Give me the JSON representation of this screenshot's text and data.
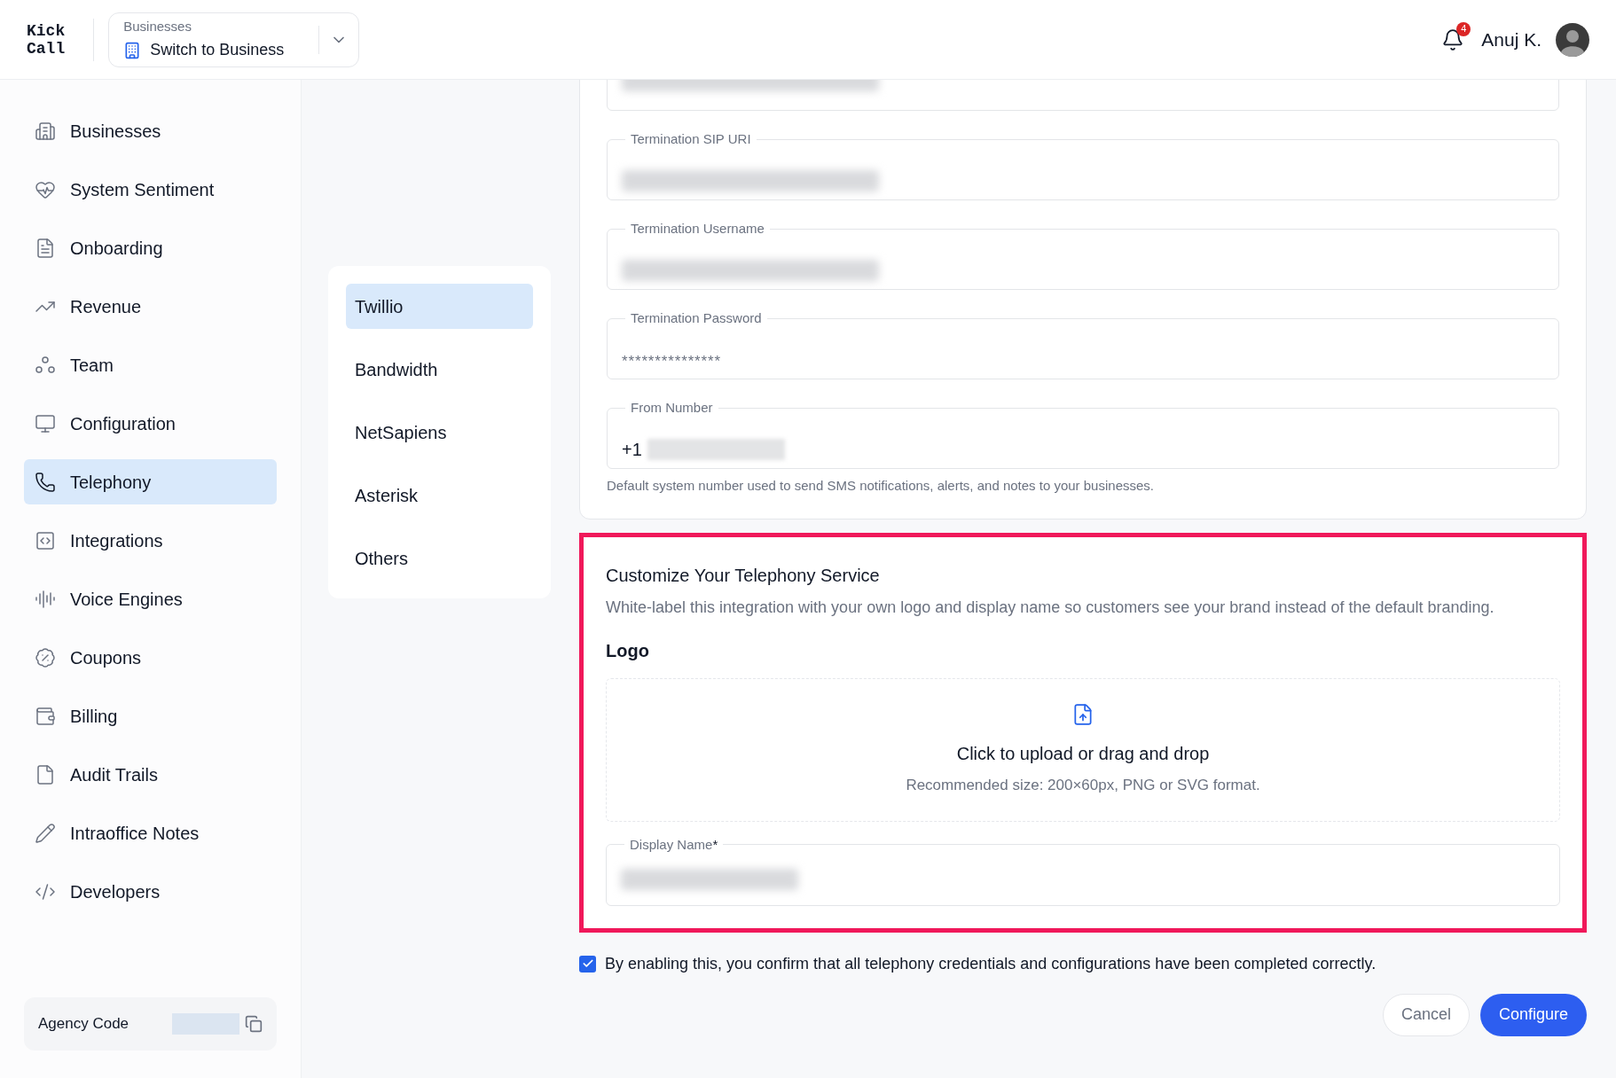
{
  "brand": {
    "line_1": "Kick",
    "line_2": "Call"
  },
  "business_switcher": {
    "label": "Businesses",
    "value": "Switch to Business"
  },
  "user": {
    "notifications": "4",
    "name": "Anuj K."
  },
  "sidebar": {
    "items": [
      {
        "label": "Businesses",
        "selected": false
      },
      {
        "label": "System Sentiment",
        "selected": false
      },
      {
        "label": "Onboarding",
        "selected": false
      },
      {
        "label": "Revenue",
        "selected": false
      },
      {
        "label": "Team",
        "selected": false
      },
      {
        "label": "Configuration",
        "selected": false
      },
      {
        "label": "Telephony",
        "selected": true
      },
      {
        "label": "Integrations",
        "selected": false
      },
      {
        "label": "Voice Engines",
        "selected": false
      },
      {
        "label": "Coupons",
        "selected": false
      },
      {
        "label": "Billing",
        "selected": false
      },
      {
        "label": "Audit Trails",
        "selected": false
      },
      {
        "label": "Intraoffice Notes",
        "selected": false
      },
      {
        "label": "Developers",
        "selected": false
      }
    ],
    "agency_code": {
      "label": "Agency Code"
    }
  },
  "providers": [
    {
      "label": "Twillio",
      "selected": true
    },
    {
      "label": "Bandwidth",
      "selected": false
    },
    {
      "label": "NetSapiens",
      "selected": false
    },
    {
      "label": "Asterisk",
      "selected": false
    },
    {
      "label": "Others",
      "selected": false
    }
  ],
  "credentials": {
    "fields": [
      {
        "kind": "redacted"
      },
      {
        "label": "Termination SIP URI",
        "kind": "redacted"
      },
      {
        "label": "Termination Username",
        "kind": "redacted"
      },
      {
        "label": "Termination Password",
        "kind": "text",
        "value": "***************"
      },
      {
        "label": "From Number",
        "kind": "phone",
        "value": "+1"
      }
    ],
    "helper": "Default system number used to send SMS notifications, alerts, and notes to your businesses."
  },
  "customize": {
    "title": "Customize Your Telephony Service",
    "description": "White-label this integration with your own logo and display name so customers see your brand instead of the default branding.",
    "logo_heading": "Logo",
    "upload_text": "Click to upload or drag and drop",
    "upload_hint": "Recommended size: 200×60px, PNG or SVG format.",
    "display_name": {
      "label": "Display Name",
      "required_mark": "*",
      "kind": "redacted"
    }
  },
  "confirm": {
    "checked": true,
    "text": "By enabling this, you confirm that all telephony credentials and configurations have been completed correctly."
  },
  "buttons": [
    {
      "label": "Cancel",
      "kind": "secondary"
    },
    {
      "label": "Configure",
      "kind": "primary"
    }
  ]
}
